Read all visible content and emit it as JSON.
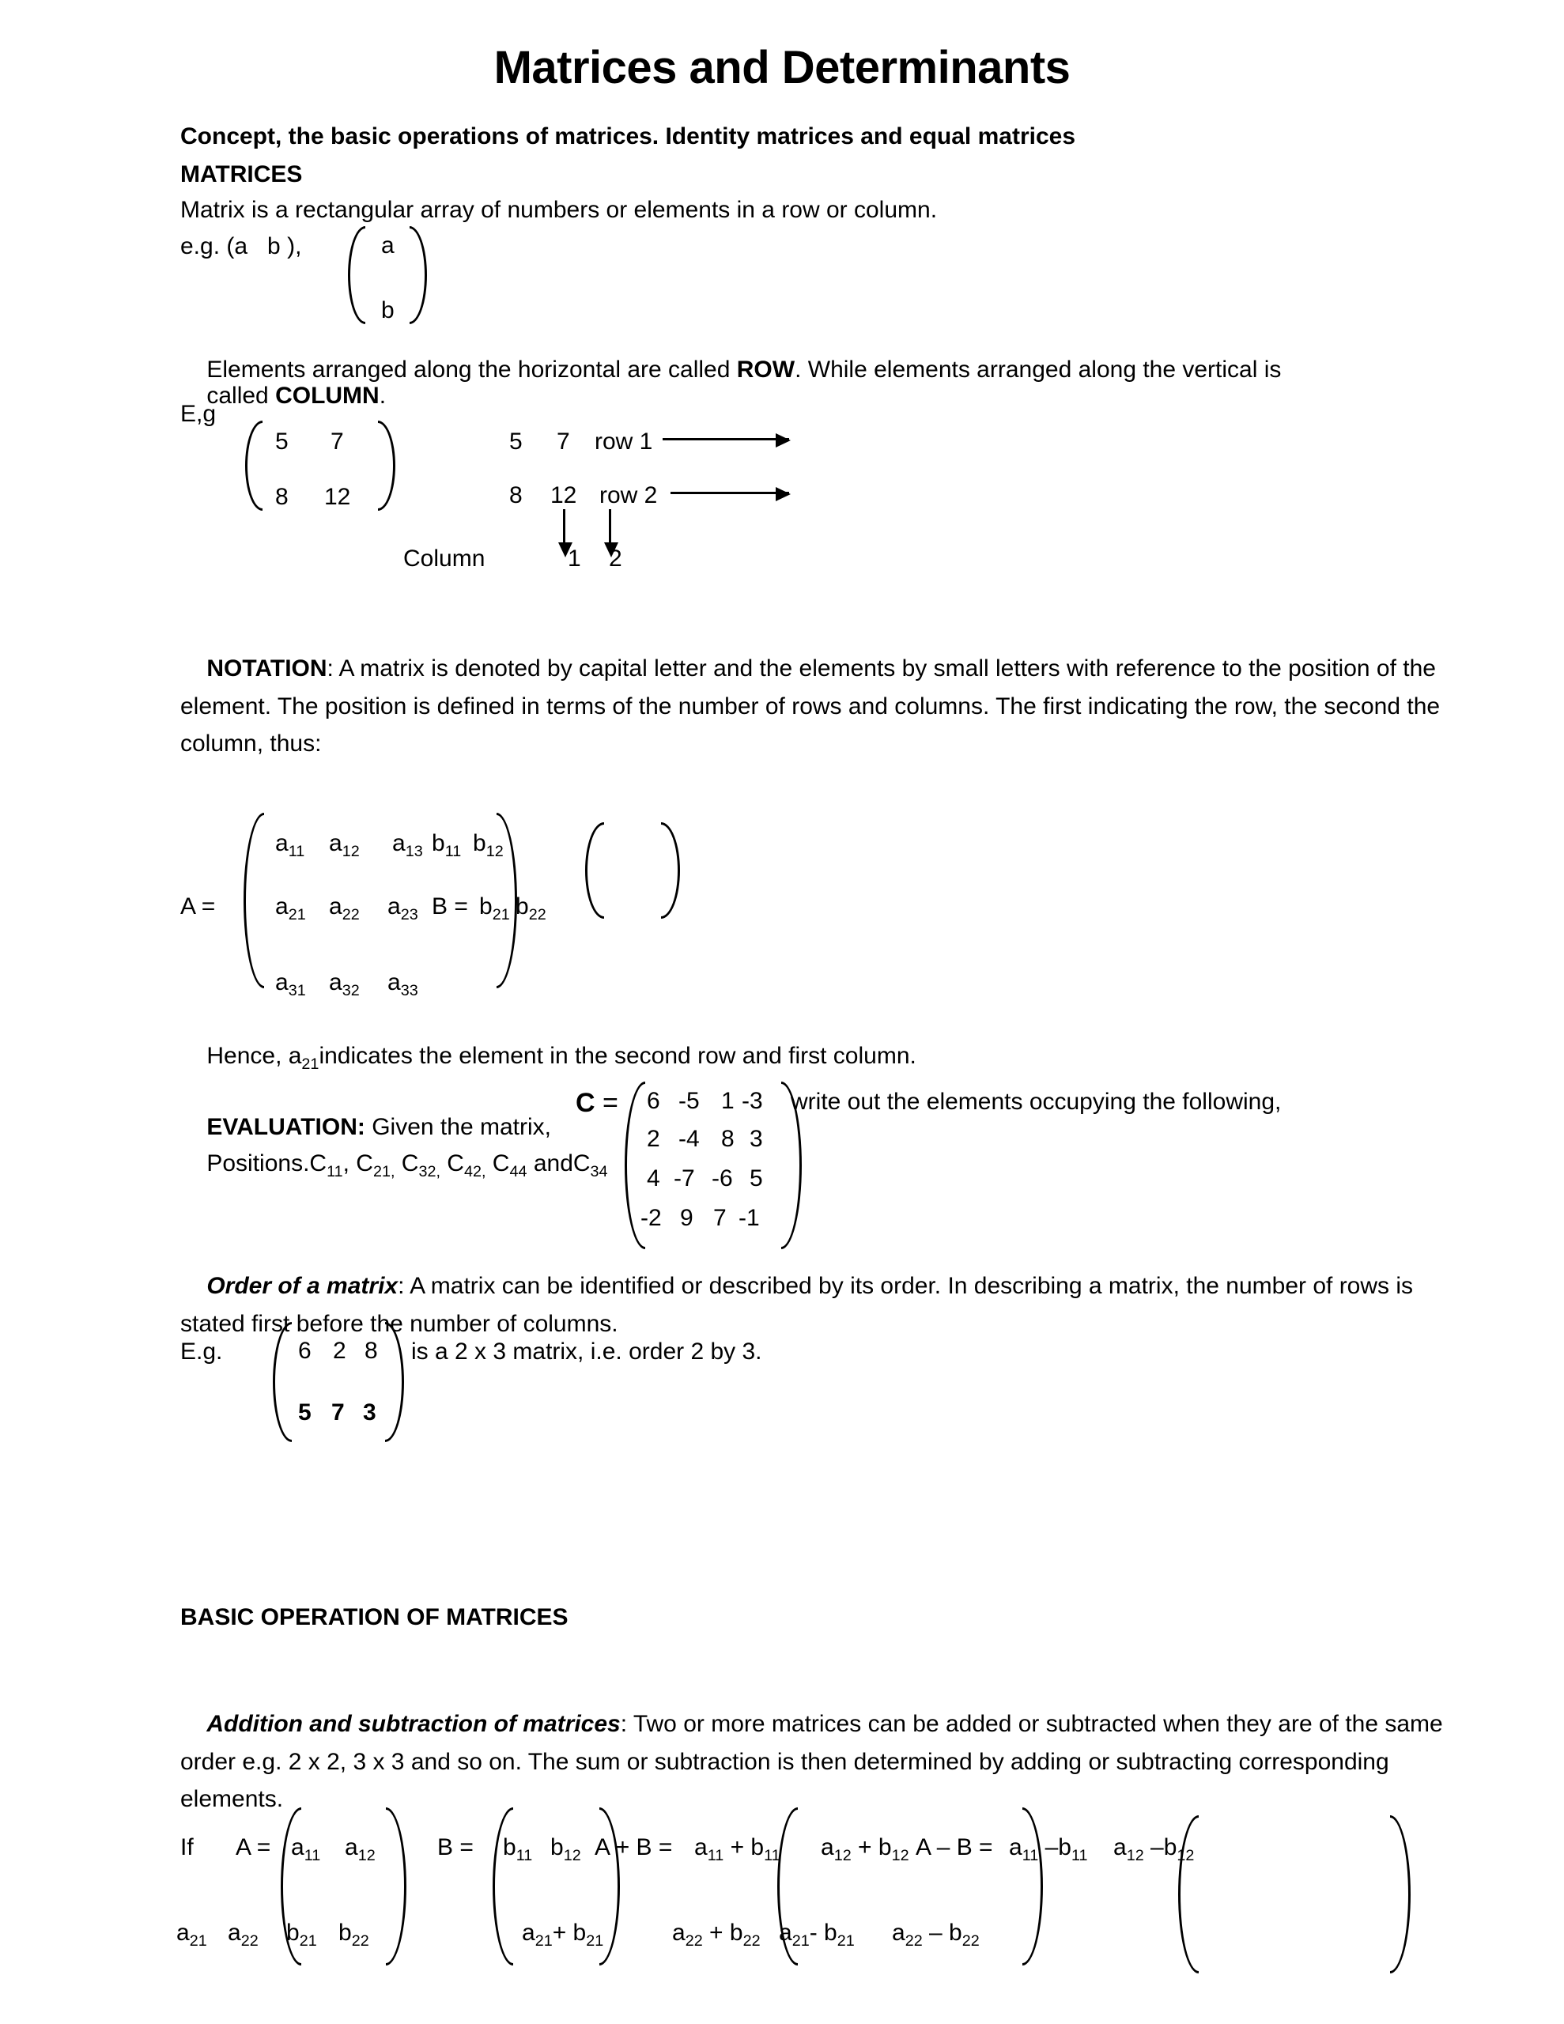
{
  "document": {
    "title": "Matrices and Determinants",
    "subtitle": "Concept, the basic operations of matrices. Identity matrices and equal matrices",
    "section_matrices_heading": "MATRICES",
    "definition_line": "Matrix is a rectangular array of numbers or elements in a row or column.",
    "eg_label": "e.g. (a   b ),",
    "col_vector": {
      "top": "a",
      "bottom": "b"
    },
    "row_column_para": {
      "line1_pre": "Elements arranged along the horizontal are called ",
      "line1_bold": "ROW",
      "line1_post": ". While elements arranged along the vertical is",
      "line2_pre": "called ",
      "line2_bold": "COLUMN",
      "line2_post": "."
    },
    "eg_short_label": "E,g",
    "example_matrix": {
      "row1": [
        "5",
        "7"
      ],
      "row2": [
        "8",
        "12"
      ]
    },
    "row_col_annotation": {
      "row1_values": [
        "5",
        "7"
      ],
      "row1_label": "row 1",
      "row2_values": [
        "8",
        "12"
      ],
      "row2_label": "row 2",
      "column_label": "Column",
      "column_numbers": [
        "1",
        "2"
      ]
    },
    "notation": {
      "heading": "NOTATION",
      "body": ": A matrix is denoted by capital letter and the elements by small letters with reference to the position of the element. The position is defined in terms of the number of rows and columns. The first indicating the row, the second the column, thus:"
    },
    "matrix_A": {
      "label": "A =",
      "row1": [
        "a11",
        "a12",
        "a13"
      ],
      "row2": [
        "a21",
        "a22",
        "a23"
      ],
      "row3": [
        "a31",
        "a32",
        "a33"
      ]
    },
    "matrix_B_overlay": {
      "label": "B =",
      "row1": [
        "b11",
        "b12"
      ],
      "row2": [
        "b21",
        "b22"
      ]
    },
    "hence_line": {
      "pre": "Hence, a",
      "sub": "21",
      "post": "indicates the element in the second row and first column."
    },
    "evaluation": {
      "heading": "EVALUATION:",
      "lead": " Given the matrix,",
      "matrix_label": "C =",
      "matrix_rows": [
        [
          "6",
          "-5",
          "1",
          "-3"
        ],
        [
          "2",
          "-4",
          "8",
          "3"
        ],
        [
          "4",
          "-7",
          "-6",
          "5"
        ],
        [
          "-2",
          "9",
          "7",
          "-1"
        ]
      ],
      "tail": "write out the elements occupying the following,",
      "positions_pre": "Positions.C",
      "positions_list": "11, C21, C32, C42, C44 andC34",
      "positions_tokens": [
        {
          "base": "Positions.C",
          "sub": "11"
        },
        {
          "base": ", C",
          "sub": "21,"
        },
        {
          "base": " C",
          "sub": "32,"
        },
        {
          "base": " C",
          "sub": "42,"
        },
        {
          "base": " C",
          "sub": "44"
        },
        {
          "base": " andC",
          "sub": "34"
        }
      ]
    },
    "order_of_matrix": {
      "heading": "Order of a matrix",
      "body": ": A matrix can be identified or described by its order. In describing a matrix, the number of rows is stated first before the number of columns."
    },
    "order_example": {
      "label": "E.g.",
      "row1": [
        "6",
        "2",
        "8"
      ],
      "row2": [
        "5",
        "7",
        "3"
      ],
      "caption": "is a 2 x 3 matrix, i.e. order 2 by 3."
    },
    "basic_operation_heading": "BASIC OPERATION OF MATRICES",
    "addition_subtraction": {
      "heading": "Addition and subtraction of matrices",
      "body": ": Two or more matrices can be added or subtracted when they are of the same order e.g. 2 x 2, 3 x 3 and so on. The sum or subtraction is then determined by adding or subtracting corresponding elements."
    },
    "bottom_math": {
      "if_label": "If",
      "A_label": "A =",
      "A_row1": [
        "a11",
        "a12"
      ],
      "A_row2": [
        "a21",
        "a22"
      ],
      "B_label": "B =",
      "B_row1": [
        "b11",
        "b12"
      ],
      "B_row2": [
        "b21",
        "b22"
      ],
      "sum_label": "A + B =",
      "sum_row1": [
        "a11 + b11",
        "a12 + b12"
      ],
      "sum_row2": [
        "a21+ b21",
        "a22 + b22"
      ],
      "diff_label": "A – B =",
      "diff_row1": [
        "a11 –b11",
        "a12 –b12"
      ],
      "diff_row2": [
        "a21- b21",
        "a22 – b22"
      ]
    }
  }
}
